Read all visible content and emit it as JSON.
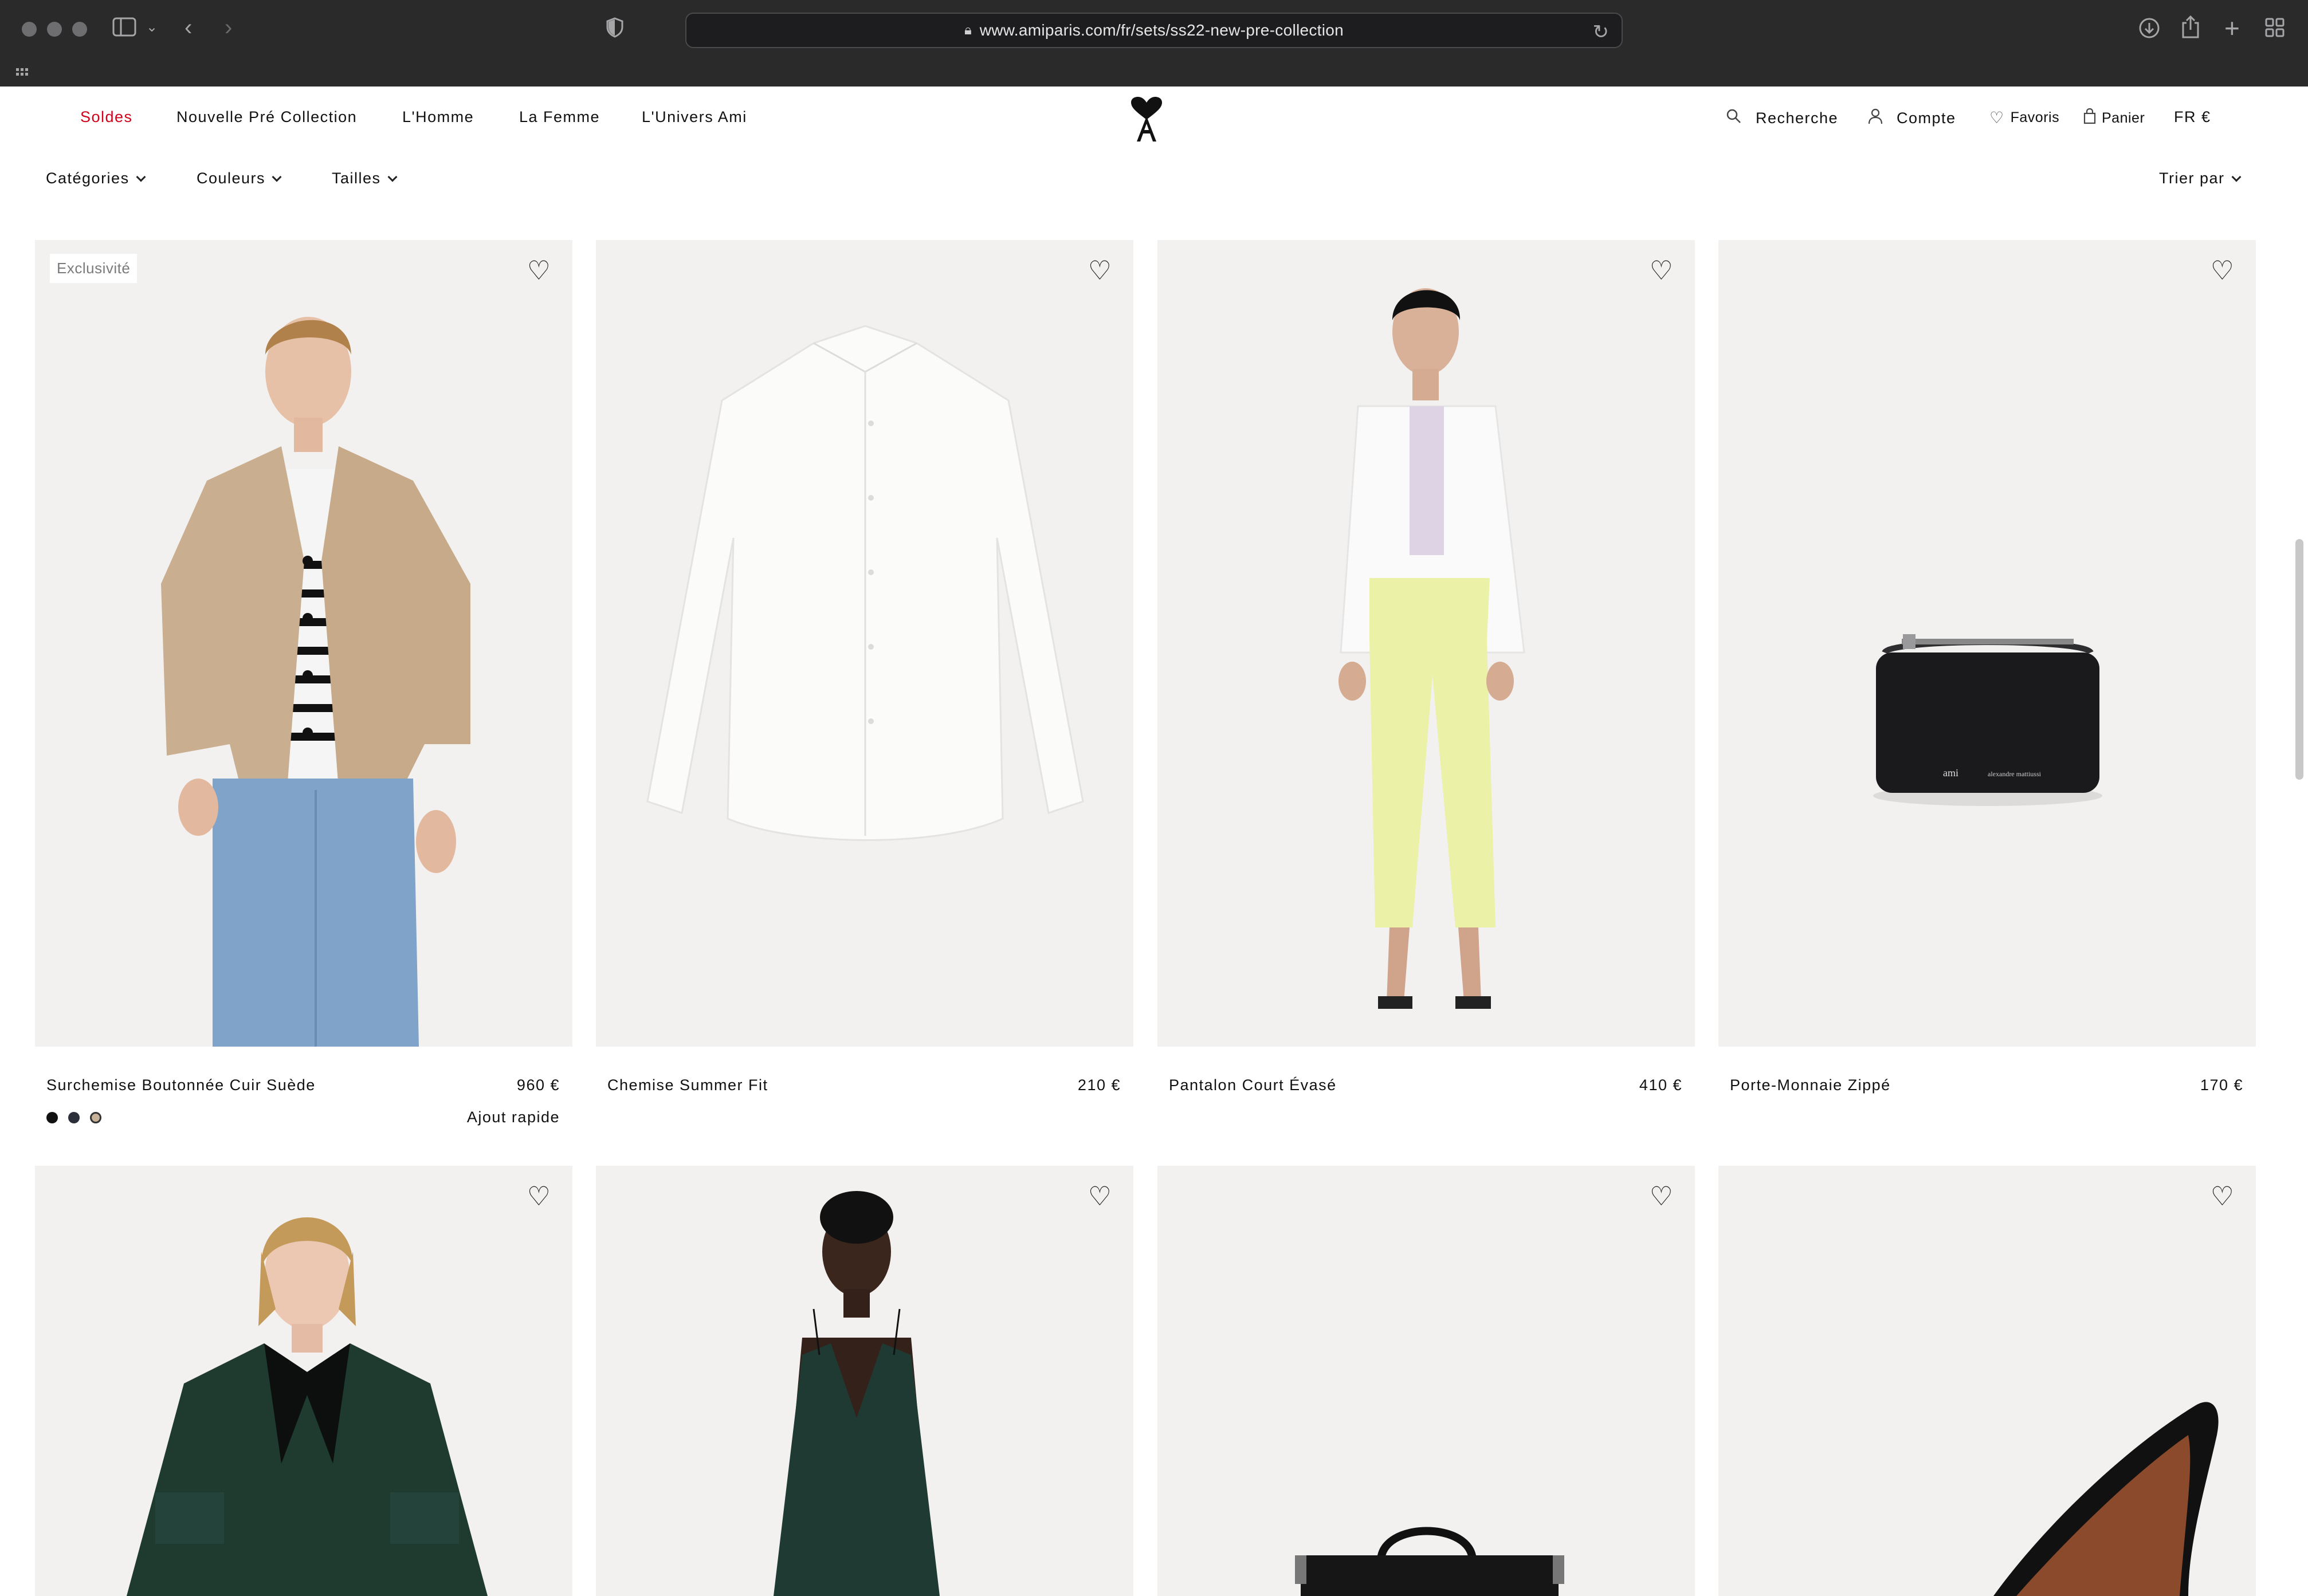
{
  "browser": {
    "url": "www.amiparis.com/fr/sets/ss22-new-pre-collection"
  },
  "nav": {
    "left": [
      {
        "label": "Soldes",
        "name": "nav-soldes"
      },
      {
        "label": "Nouvelle Pré Collection",
        "name": "nav-nouvelle-pre-collection"
      },
      {
        "label": "L'Homme",
        "name": "nav-homme"
      },
      {
        "label": "La Femme",
        "name": "nav-femme"
      },
      {
        "label": "L'Univers Ami",
        "name": "nav-univers-ami"
      }
    ],
    "search_label": "Recherche",
    "account_label": "Compte",
    "favorites_label": "Favoris",
    "cart_label": "Panier",
    "locale_label": "FR €"
  },
  "filters": {
    "categories": "Catégories",
    "colors": "Couleurs",
    "sizes": "Tailles",
    "sort": "Trier par"
  },
  "products": [
    {
      "title": "Surchemise Boutonnée Cuir Suède",
      "price": "960 €",
      "badge": "Exclusivité",
      "swatches": [
        "#111111",
        "#2a2f3a",
        "#c8b199"
      ],
      "quick_add": "Ajout rapide"
    },
    {
      "title": "Chemise Summer Fit",
      "price": "210 €"
    },
    {
      "title": "Pantalon Court Évasé",
      "price": "410 €"
    },
    {
      "title": "Porte-Monnaie Zippé",
      "price": "170 €"
    }
  ],
  "icons": {
    "favorite": "heart-outline-icon",
    "search": "search-icon",
    "account": "user-icon",
    "cart": "bag-icon"
  },
  "colors": {
    "sale_red": "#d0021b",
    "product_bg": "#f2f1f0",
    "chrome_bg": "#2a2a2b"
  }
}
